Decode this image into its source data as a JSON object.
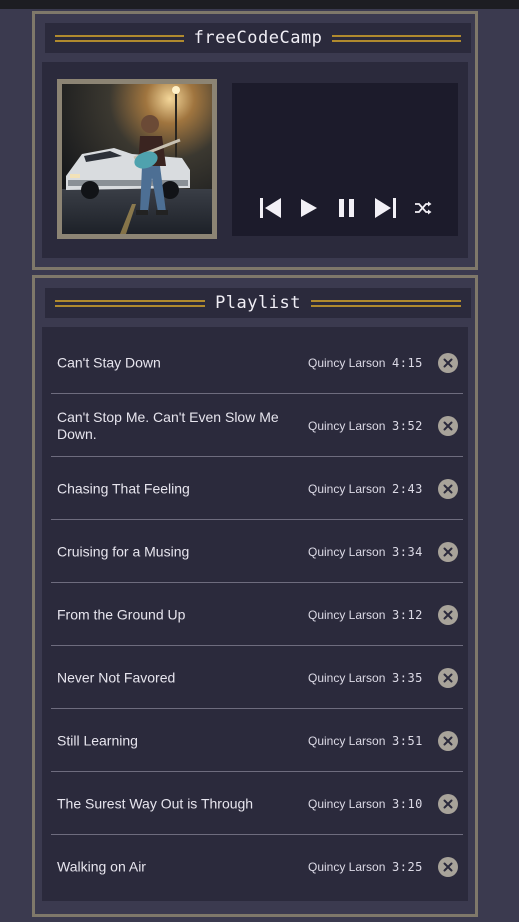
{
  "player": {
    "title": "freeCodeCamp",
    "album_art_alt": "Album cover: a guitarist leaning on a white car at night"
  },
  "controls": [
    {
      "name": "previous-button",
      "icon": "skip-back-icon"
    },
    {
      "name": "play-button",
      "icon": "play-icon"
    },
    {
      "name": "pause-button",
      "icon": "pause-icon"
    },
    {
      "name": "next-button",
      "icon": "skip-forward-icon"
    },
    {
      "name": "shuffle-button",
      "icon": "shuffle-icon"
    }
  ],
  "playlist": {
    "title": "Playlist",
    "tracks": [
      {
        "title": "Can't Stay Down",
        "artist": "Quincy Larson",
        "duration": "4:15"
      },
      {
        "title": "Can't Stop Me. Can't Even Slow Me Down.",
        "artist": "Quincy Larson",
        "duration": "3:52"
      },
      {
        "title": "Chasing That Feeling",
        "artist": "Quincy Larson",
        "duration": "2:43"
      },
      {
        "title": "Cruising for a Musing",
        "artist": "Quincy Larson",
        "duration": "3:34"
      },
      {
        "title": "From the Ground Up",
        "artist": "Quincy Larson",
        "duration": "3:12"
      },
      {
        "title": "Never Not Favored",
        "artist": "Quincy Larson",
        "duration": "3:35"
      },
      {
        "title": "Still Learning",
        "artist": "Quincy Larson",
        "duration": "3:51"
      },
      {
        "title": "The Surest Way Out is Through",
        "artist": "Quincy Larson",
        "duration": "3:10"
      },
      {
        "title": "Walking on Air",
        "artist": "Quincy Larson",
        "duration": "3:25"
      }
    ]
  },
  "colors": {
    "background": "#3b3a4f",
    "panel": "#2b2a3c",
    "controls_box": "#1c1b2b",
    "border": "#7f786a",
    "title_lines": "#b08a2e",
    "delete_button": "#a8a39a"
  }
}
